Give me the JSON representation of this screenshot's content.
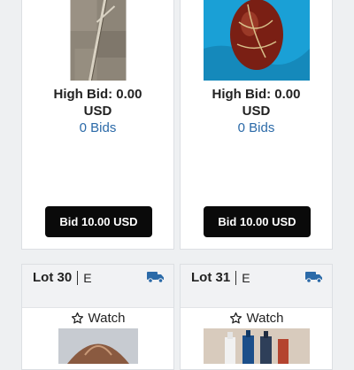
{
  "cards_top": [
    {
      "high_bid": "High Bid: 0.00",
      "currency": "USD",
      "bids": "0 Bids",
      "bid_button": "Bid 10.00 USD",
      "image": "walking-stick-photo"
    },
    {
      "high_bid": "High Bid: 0.00",
      "currency": "USD",
      "bids": "0 Bids",
      "bid_button": "Bid 10.00 USD",
      "image": "painted-vase-photo"
    }
  ],
  "cards_bottom": [
    {
      "lot_label": "Lot 30",
      "lot_code": "E",
      "watch_label": "Watch",
      "shipping_icon": "truck-icon",
      "image": "leather-item-photo"
    },
    {
      "lot_label": "Lot 31",
      "lot_code": "E",
      "watch_label": "Watch",
      "shipping_icon": "truck-icon",
      "image": "bottles-photo"
    }
  ],
  "colors": {
    "link": "#2b6aa8",
    "button_bg": "#0a0a0a",
    "shipping_icon": "#2b6aa8"
  }
}
